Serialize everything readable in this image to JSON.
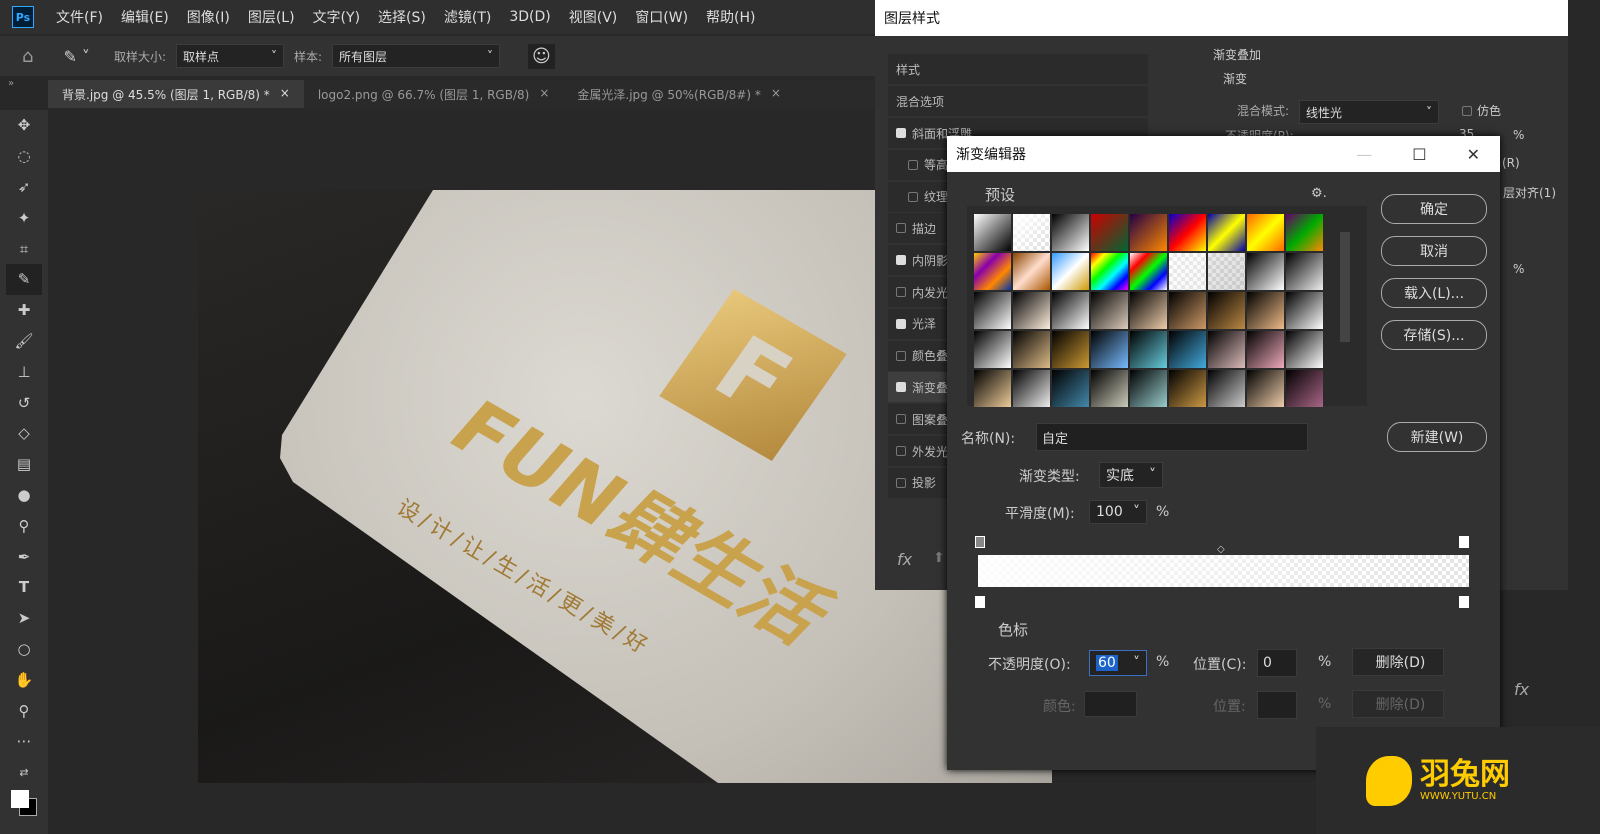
{
  "menu": {
    "items": [
      "文件(F)",
      "编辑(E)",
      "图像(I)",
      "图层(L)",
      "文字(Y)",
      "选择(S)",
      "滤镜(T)",
      "3D(D)",
      "视图(V)",
      "窗口(W)",
      "帮助(H)"
    ]
  },
  "options": {
    "sample_size_label": "取样大小:",
    "sample_size_value": "取样点",
    "sample_label": "样本:",
    "sample_value": "所有图层"
  },
  "tabs": [
    {
      "label": "背景.jpg @ 45.5% (图层 1, RGB/8) *"
    },
    {
      "label": "logo2.png @ 66.7% (图层 1, RGB/8)"
    },
    {
      "label": "金属光泽.jpg @ 50%(RGB/8#) *"
    }
  ],
  "canvas": {
    "logo_text": "FUN肆生活",
    "slogan": "设/计/让/生/活/更/美/好"
  },
  "layer_style": {
    "title": "图层样式",
    "styles_header": "样式",
    "blend_options": "混合选项",
    "items": [
      {
        "label": "斜面和浮雕",
        "checked": true
      },
      {
        "label": "等高",
        "checked": false
      },
      {
        "label": "纹理",
        "checked": false
      },
      {
        "label": "描边",
        "checked": false
      },
      {
        "label": "内阴影",
        "checked": true
      },
      {
        "label": "内发光",
        "checked": false
      },
      {
        "label": "光泽",
        "checked": true
      },
      {
        "label": "颜色叠",
        "checked": false
      },
      {
        "label": "渐变叠",
        "checked": true
      },
      {
        "label": "图案叠",
        "checked": false
      },
      {
        "label": "外发光",
        "checked": false
      },
      {
        "label": "投影",
        "checked": false
      }
    ],
    "section": "渐变叠加",
    "group": "渐变",
    "blend_mode_label": "混合模式:",
    "blend_mode": "线性光",
    "dither": "仿色",
    "opacity_label": "不透明度(P):",
    "opacity": "35",
    "pct": "%",
    "reverse": "(R)",
    "align": "层对齐(1)",
    "fx": "fx"
  },
  "gradient_editor": {
    "title": "渐变编辑器",
    "presets_label": "预设",
    "ok": "确定",
    "cancel": "取消",
    "load": "载入(L)...",
    "save": "存储(S)...",
    "name_label": "名称(N):",
    "name_value": "自定",
    "new": "新建(W)",
    "type_label": "渐变类型:",
    "type_value": "实底",
    "smooth_label": "平滑度(M):",
    "smooth_value": "100",
    "pct": "%",
    "stops_label": "色标",
    "opacity_label": "不透明度(O):",
    "opacity_value": "60",
    "location_label": "位置(C):",
    "location_value": "0",
    "delete": "删除(D)",
    "color_label": "颜色:",
    "location2_label": "位置:",
    "delete2": "删除(D)",
    "presets": [
      [
        "#fff",
        "#000"
      ],
      [
        "#fff",
        "transparent"
      ],
      [
        "#000",
        "#fff"
      ],
      [
        "#c00",
        "#063"
      ],
      [
        "#204",
        "#f80"
      ],
      [
        "#00c",
        "#f00",
        "#ff0"
      ],
      [
        "#00a",
        "#ff0",
        "#00a"
      ],
      [
        "#f60",
        "#ff0",
        "#f60"
      ],
      [
        "#606",
        "#0a0",
        "#f80"
      ],
      [
        "#fc0",
        "#80a",
        "#f80",
        "#03a"
      ],
      [
        "#840",
        "#fdc",
        "#a50"
      ],
      [
        "#39f",
        "#fff",
        "#c90"
      ],
      [
        "#f00",
        "#ff0",
        "#0f0",
        "#0ff",
        "#00f",
        "#f0f"
      ],
      [
        "#fff",
        "#f00",
        "#0f0",
        "#00f",
        "#fff"
      ],
      [
        "#fff",
        "#eee"
      ],
      [
        "#ccc",
        "#aaa"
      ],
      [
        "#000",
        "#fff"
      ],
      [
        "#000",
        "#eee"
      ],
      [
        "#000",
        "#fff"
      ],
      [
        "#000",
        "#fed"
      ],
      [
        "#000",
        "#fff"
      ],
      [
        "#000",
        "#dcb"
      ],
      [
        "#000",
        "#eca"
      ],
      [
        "#000",
        "#c96"
      ],
      [
        "#000",
        "#b84"
      ],
      [
        "#000",
        "#eb8"
      ],
      [
        "#000",
        "#fff"
      ],
      [
        "#000",
        "#fff"
      ],
      [
        "#000",
        "#db8"
      ],
      [
        "#000",
        "#c93"
      ],
      [
        "#000",
        "#7bf"
      ],
      [
        "#000",
        "#6cd"
      ],
      [
        "#000",
        "#4ad"
      ],
      [
        "#000",
        "#dbb"
      ],
      [
        "#000",
        "#eab"
      ],
      [
        "#000",
        "#fff"
      ],
      [
        "#000",
        "#ec9"
      ],
      [
        "#000",
        "#eee"
      ],
      [
        "#000",
        "#48a"
      ],
      [
        "#000",
        "#ccb"
      ],
      [
        "#000",
        "#9cc"
      ],
      [
        "#000",
        "#c94"
      ],
      [
        "#000",
        "#ccc"
      ],
      [
        "#000",
        "#eca"
      ],
      [
        "#000",
        "#a68"
      ]
    ]
  },
  "watermark": {
    "brand": "羽兔网",
    "url": "WWW.YUTU.CN",
    "color": "#ffcc00"
  }
}
